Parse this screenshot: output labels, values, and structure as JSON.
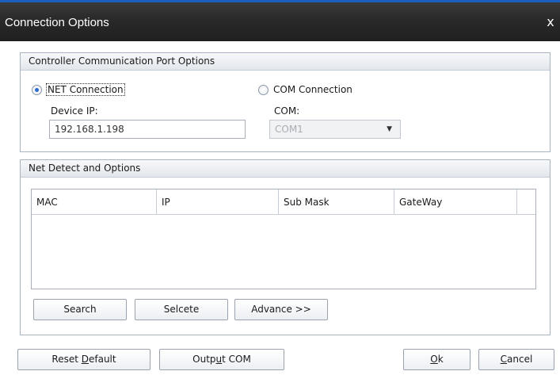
{
  "window": {
    "title": "Connection Options",
    "close_glyph": "x"
  },
  "port_options": {
    "header": "Controller Communication Port Options",
    "net": {
      "label": "NET Connection",
      "selected": true,
      "device_ip_label": "Device IP:",
      "device_ip_value": "192.168.1.198"
    },
    "com": {
      "label": "COM Connection",
      "selected": false,
      "com_label": "COM:",
      "com_value": "COM1"
    }
  },
  "net_detect": {
    "header": "Net Detect and Options",
    "columns": [
      "MAC",
      "IP",
      "Sub Mask",
      "GateWay"
    ],
    "rows": [],
    "buttons": {
      "search": "Search",
      "select": "Selcete",
      "advance": "Advance >>"
    }
  },
  "footer": {
    "reset_default_pre": "Reset ",
    "reset_default_key": "D",
    "reset_default_post": "efault",
    "output_com_pre": "Outp",
    "output_com_key": "u",
    "output_com_post": "t COM",
    "ok_key": "O",
    "ok_post": "k",
    "cancel_key": "C",
    "cancel_post": "ancel"
  }
}
